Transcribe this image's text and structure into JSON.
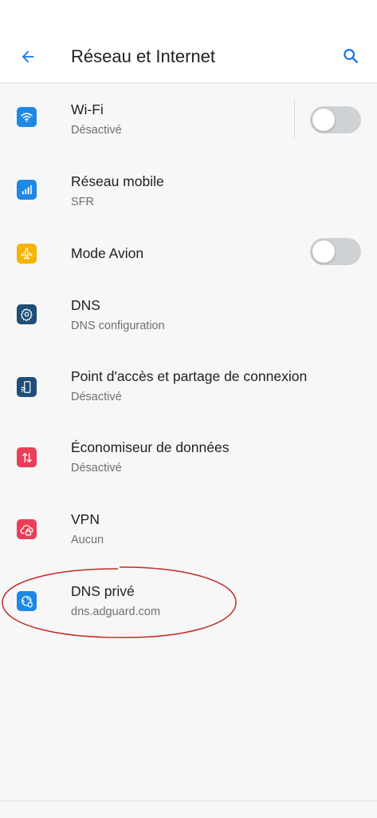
{
  "header": {
    "title": "Réseau et Internet",
    "back_icon": "arrow-back-icon",
    "search_icon": "search-icon"
  },
  "colors": {
    "accent": "#1a73e8",
    "wifi": "#1e88e5",
    "mobile": "#1e88e5",
    "airplane": "#f4b400",
    "dns": "#1f4e79",
    "hotspot": "#1f4e79",
    "datasaver": "#ea3e58",
    "vpn": "#ea3e58",
    "private_dns": "#1e88e5",
    "annotation": "#c62828"
  },
  "items": [
    {
      "label": "Wi-Fi",
      "sub": "Désactivé",
      "icon": "wifi-icon",
      "toggle": false
    },
    {
      "label": "Réseau mobile",
      "sub": "SFR",
      "icon": "cellular-signal-icon"
    },
    {
      "label": "Mode Avion",
      "icon": "airplane-icon",
      "toggle": false
    },
    {
      "label": "DNS",
      "sub": "DNS configuration",
      "icon": "gear-icon"
    },
    {
      "label": "Point d'accès et partage de connexion",
      "sub": "Désactivé",
      "icon": "hotspot-icon"
    },
    {
      "label": "Économiseur de données",
      "sub": "Désactivé",
      "icon": "data-saver-icon"
    },
    {
      "label": "VPN",
      "sub": "Aucun",
      "icon": "cloud-lock-icon"
    },
    {
      "label": "DNS privé",
      "sub": "dns.adguard.com",
      "icon": "private-dns-icon",
      "annotated": true
    }
  ]
}
